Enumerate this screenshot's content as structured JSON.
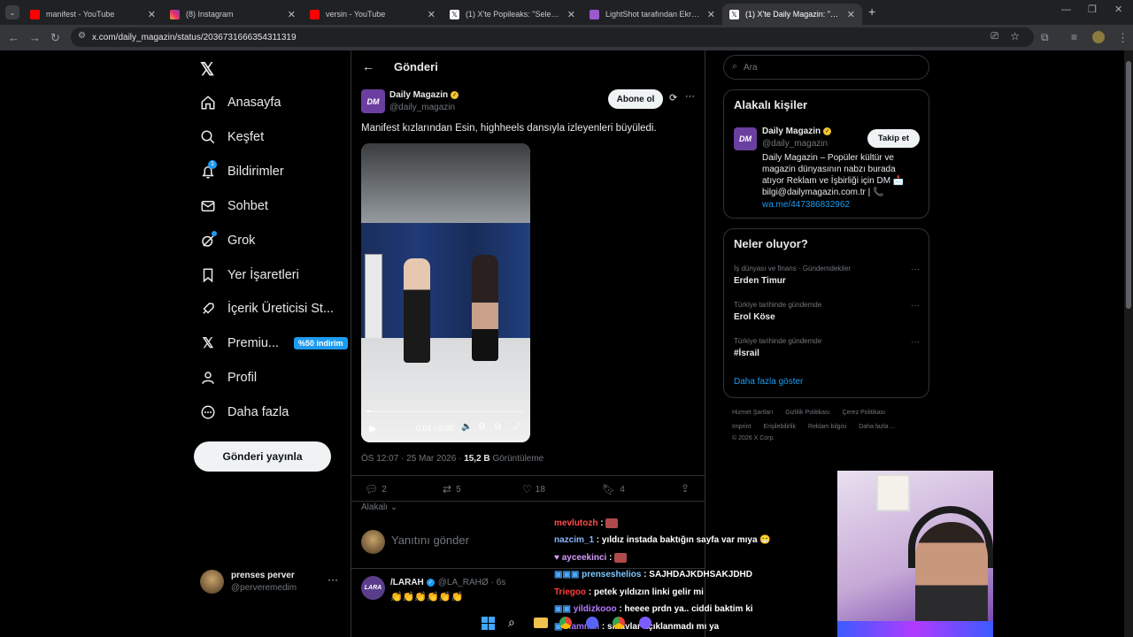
{
  "browser": {
    "tabs": [
      {
        "title": "manifest - YouTube",
        "icon": "youtube-icon"
      },
      {
        "title": "(8) Instagram",
        "icon": "instagram-icon"
      },
      {
        "title": "versin - YouTube",
        "icon": "youtube-icon"
      },
      {
        "title": "(1) X'te Popileaks: \"Selena Gom",
        "icon": "x-icon"
      },
      {
        "title": "LightShot tarafından Ekran Gör",
        "icon": "lightshot-icon"
      },
      {
        "title": "(1) X'te Daily Magazin: \"Manife",
        "icon": "x-icon"
      }
    ],
    "url": "x.com/daily_magazin/status/2036731666354311319"
  },
  "sidebar": {
    "items": [
      {
        "label": "Anasayfa",
        "icon": "home-icon"
      },
      {
        "label": "Keşfet",
        "icon": "search-icon"
      },
      {
        "label": "Bildirimler",
        "icon": "bell-icon",
        "badge": "1"
      },
      {
        "label": "Sohbet",
        "icon": "mail-icon"
      },
      {
        "label": "Grok",
        "icon": "grok-icon"
      },
      {
        "label": "Yer İşaretleri",
        "icon": "bookmark-icon"
      },
      {
        "label": "İçerik Üreticisi St...",
        "icon": "rocket-icon"
      },
      {
        "label": "Premiu...",
        "icon": "x-logo-icon",
        "promo": "%50 indirim"
      },
      {
        "label": "Profil",
        "icon": "person-icon"
      },
      {
        "label": "Daha fazla",
        "icon": "more-circle-icon"
      }
    ],
    "post_button": "Gönderi yayınla",
    "account": {
      "name": "prenses perver",
      "handle": "@perveremedim"
    }
  },
  "post": {
    "header_title": "Gönderi",
    "author_name": "Daily Magazin",
    "author_handle": "@daily_magazin",
    "avatar_text": "DM",
    "subscribe_label": "Abone ol",
    "text": "Manifest kızlarından Esin, highheels dansıyla izleyenleri büyüledi.",
    "video_time": "0:01 / 0:35",
    "meta_time": "ÖS 12:07 · 25 Mar 2026 ·",
    "views": "15,2 B",
    "views_label": "Görüntüleme",
    "stats": {
      "replies": "2",
      "reposts": "5",
      "likes": "18",
      "bookmarks": "4"
    },
    "relevance_label": "Alakalı",
    "reply_placeholder": "Yanıtını gönder"
  },
  "reply": {
    "name": "/LARAH",
    "handle": "@LA_RAHØ",
    "time": "· 6s",
    "text": "👏👏👏👏👏👏"
  },
  "search": {
    "placeholder": "Ara"
  },
  "related": {
    "title": "Alakalı kişiler",
    "name": "Daily Magazin",
    "handle": "@daily_magazin",
    "follow_label": "Takip et",
    "bio": "Daily Magazin – Popüler kültür ve magazin dünyasının nabzı burada atıyor Reklam ve İşbirliği için DM 📩 bilgi@dailymagazin.com.tr | 📞",
    "link": "wa.me/447386832962"
  },
  "trends": {
    "title": "Neler oluyor?",
    "items": [
      {
        "meta": "İş dünyası ve finans · Gündemdekiler",
        "title": "Erden Timur"
      },
      {
        "meta": "Türkiye tarihinde gündemde",
        "title": "Erol Köse"
      },
      {
        "meta": "Türkiye tarihinde gündemde",
        "title": "#İsrail"
      }
    ],
    "show_more": "Daha fazla göster"
  },
  "footer": {
    "links_row1": [
      "Hizmet Şartları",
      "Gizlilik Politikası",
      "Çerez Politikası"
    ],
    "links_row2": [
      "Imprint",
      "Erişilebilirlik",
      "Reklam bilgisi",
      "Daha fazla ..."
    ],
    "copyright": "© 2026 X Corp."
  },
  "chat": [
    {
      "user": "mevlutozh",
      "color": "#ff4d4d",
      "msg": ""
    },
    {
      "user": "nazcim_1",
      "color": "#8ab4ff",
      "msg": "yıldız instada baktığın sayfa var mıya 😁"
    },
    {
      "user": "ayceekinci",
      "color": "#d59cff",
      "msg": ""
    },
    {
      "user": "prenseshelios",
      "color": "#7ec8ff",
      "msg": "SAJHDAJKDHSAKJDHD"
    },
    {
      "user": "Triegoo",
      "color": "#ff3b3b",
      "msg": "petek yıldızın linki gelir mi"
    },
    {
      "user": "yildizkooo",
      "color": "#b57cff",
      "msg": "heeee prdn ya.. ciddi baktim ki"
    },
    {
      "user": "Rammiii",
      "color": "#a070ff",
      "msg": "sınavlar açıklanmadı mı ya"
    }
  ],
  "colors": {
    "accent": "#1d9bf0",
    "verified": "#f4c430",
    "avatar": "#6b3fa0"
  }
}
